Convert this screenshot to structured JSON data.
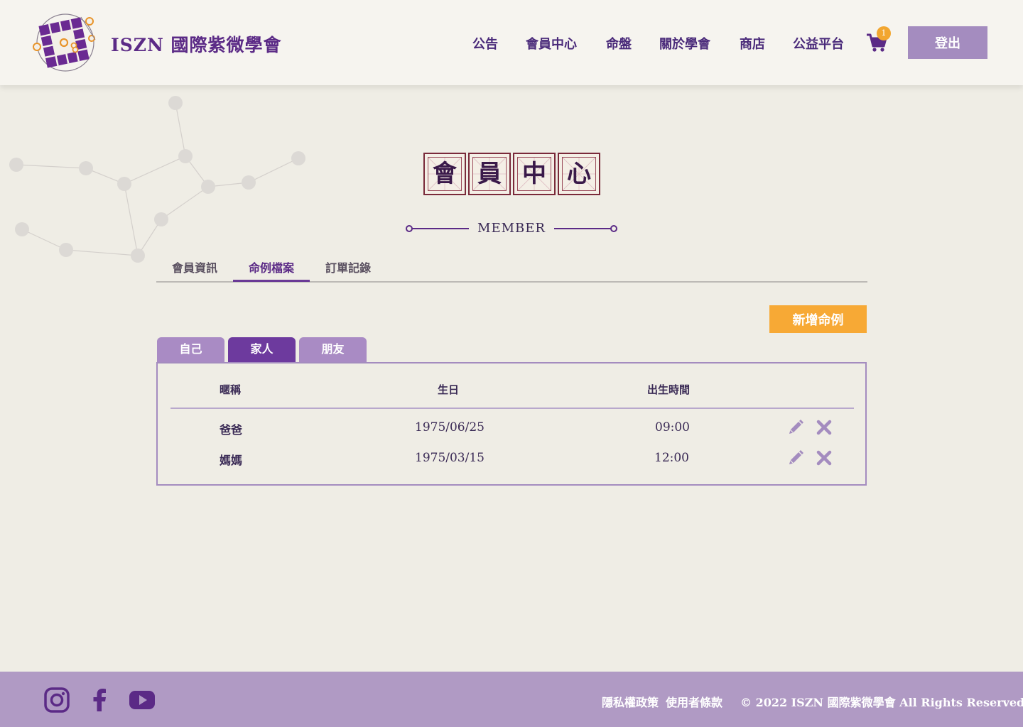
{
  "header": {
    "site_name": "ISZN 國際紫微學會",
    "nav": [
      "公告",
      "會員中心",
      "命盤",
      "關於學會",
      "商店",
      "公益平台"
    ],
    "cart_count": "1",
    "logout_label": "登出"
  },
  "page": {
    "title_chars": [
      "會",
      "員",
      "中",
      "心"
    ],
    "subtitle": "MEMBER"
  },
  "tabs": [
    "會員資訊",
    "命例檔案",
    "訂單記錄"
  ],
  "active_tab": 1,
  "add_button": "新增命例",
  "sub_tabs": [
    "自己",
    "家人",
    "朋友"
  ],
  "active_sub_tab": 1,
  "table": {
    "columns": [
      "暱稱",
      "生日",
      "出生時間"
    ],
    "rows": [
      {
        "name": "爸爸",
        "birthday": "1975/06/25",
        "time": "09:00"
      },
      {
        "name": "媽媽",
        "birthday": "1975/03/15",
        "time": "12:00"
      }
    ]
  },
  "footer": {
    "links": [
      "隱私權政策",
      "使用者條款"
    ],
    "copyright": "© 2022 ISZN 國際紫微學會 All Rights Reserved."
  },
  "colors": {
    "brand_purple": "#5b2a86",
    "accent_orange": "#f7a935",
    "footer_bg": "#b09ac4",
    "logout_bg": "#a48cbf"
  }
}
